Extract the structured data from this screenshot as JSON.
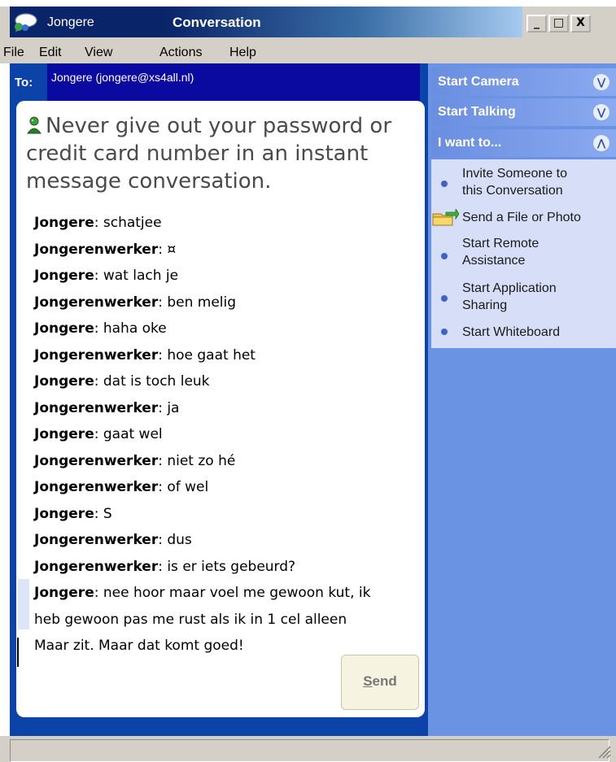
{
  "window": {
    "contact_name": "Jongere",
    "title": "Conversation",
    "controls": {
      "minimize": "_",
      "maximize": "□",
      "close": "X"
    }
  },
  "menu": [
    "File",
    "Edit",
    "View",
    "Actions",
    "Help"
  ],
  "to": {
    "label": "To:",
    "value": "Jongere (jongere@xs4all.nl)"
  },
  "warning": "Never give out your password or credit card number in an instant message conversation.",
  "messages": [
    {
      "sender": "Jongere",
      "text": ": schatjee"
    },
    {
      "sender": "Jongerenwerker",
      "text": ": ¤"
    },
    {
      "sender": "Jongere",
      "text": ": wat lach je"
    },
    {
      "sender": "Jongerenwerker",
      "text": ": ben melig"
    },
    {
      "sender": "Jongere",
      "text": ": haha oke"
    },
    {
      "sender": "Jongerenwerker",
      "text": ": hoe gaat het"
    },
    {
      "sender": "Jongere",
      "text": ": dat is toch leuk"
    },
    {
      "sender": "Jongerenwerker",
      "text": ": ja"
    },
    {
      "sender": "Jongere",
      "text": ": gaat wel"
    },
    {
      "sender": "Jongerenwerker",
      "text": ": niet zo hé"
    },
    {
      "sender": "Jongerenwerker",
      "text": ": of wel"
    },
    {
      "sender": "Jongere",
      "text": ": S"
    },
    {
      "sender": "Jongerenwerker",
      "text": ": dus"
    },
    {
      "sender": "Jongerenwerker",
      "text": ": is er iets gebeurd?"
    },
    {
      "sender": "Jongere",
      "text": ": nee hoor maar voel me gewoon kut, ik"
    }
  ],
  "message_continuation": [
    "heb gewoon pas me rust als ik in 1 cel alleen",
    "Maar zit. Maar dat komt goed!"
  ],
  "send_button": {
    "mnemonic": "S",
    "rest": "end"
  },
  "task_pane": {
    "sections": [
      "Start Camera",
      "Start Talking",
      "I want to..."
    ],
    "chevrons": [
      "expand",
      "expand",
      "collapse"
    ],
    "tasks": [
      {
        "line1": "Invite Someone to",
        "line2": "this Conversation",
        "icon": "bullet-icon"
      },
      {
        "line1": "Send a File or Photo",
        "line2": "",
        "icon": "folder-arrow-icon"
      },
      {
        "line1": "Start Remote",
        "line2": "Assistance",
        "icon": "bullet-icon"
      },
      {
        "line1": "Start Application",
        "line2": "Sharing",
        "icon": "bullet-icon"
      },
      {
        "line1": "Start Whiteboard",
        "line2": "",
        "icon": "bullet-icon"
      }
    ]
  },
  "colors": {
    "conversation_bg": "#0b43a8",
    "task_pane_bg": "#6b93e3",
    "title_active": "#0a246a"
  }
}
